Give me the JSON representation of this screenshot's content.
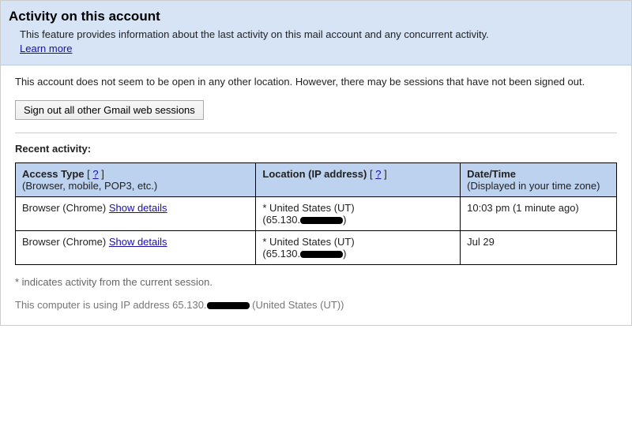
{
  "header": {
    "title": "Activity on this account",
    "description": "This feature provides information about the last activity on this mail account and any concurrent activity.",
    "learn_more": "Learn more"
  },
  "status_text": "This account does not seem to be open in any other location. However, there may be sessions that have not been signed out.",
  "sign_out_button": "Sign out all other Gmail web sessions",
  "recent_activity_label": "Recent activity:",
  "table": {
    "headers": {
      "access_type_title": "Access Type",
      "access_type_sub": "(Browser, mobile, POP3, etc.)",
      "location_title": "Location (IP address)",
      "date_title": "Date/Time",
      "date_sub": "(Displayed in your time zone)",
      "help": "?"
    },
    "show_details": "Show details",
    "rows": [
      {
        "access": "Browser (Chrome)",
        "location_line1": "* United States (UT)",
        "ip_prefix": "(65.130.",
        "ip_suffix": ")",
        "date": "10:03 pm (1 minute ago)"
      },
      {
        "access": "Browser (Chrome)",
        "location_line1": "* United States (UT)",
        "ip_prefix": "(65.130.",
        "ip_suffix": ")",
        "date": "Jul 29"
      }
    ]
  },
  "footer": {
    "asterisk_note": "* indicates activity from the current session.",
    "ip_prefix": "This computer is using IP address 65.130.",
    "ip_suffix": " (United States (UT))"
  }
}
